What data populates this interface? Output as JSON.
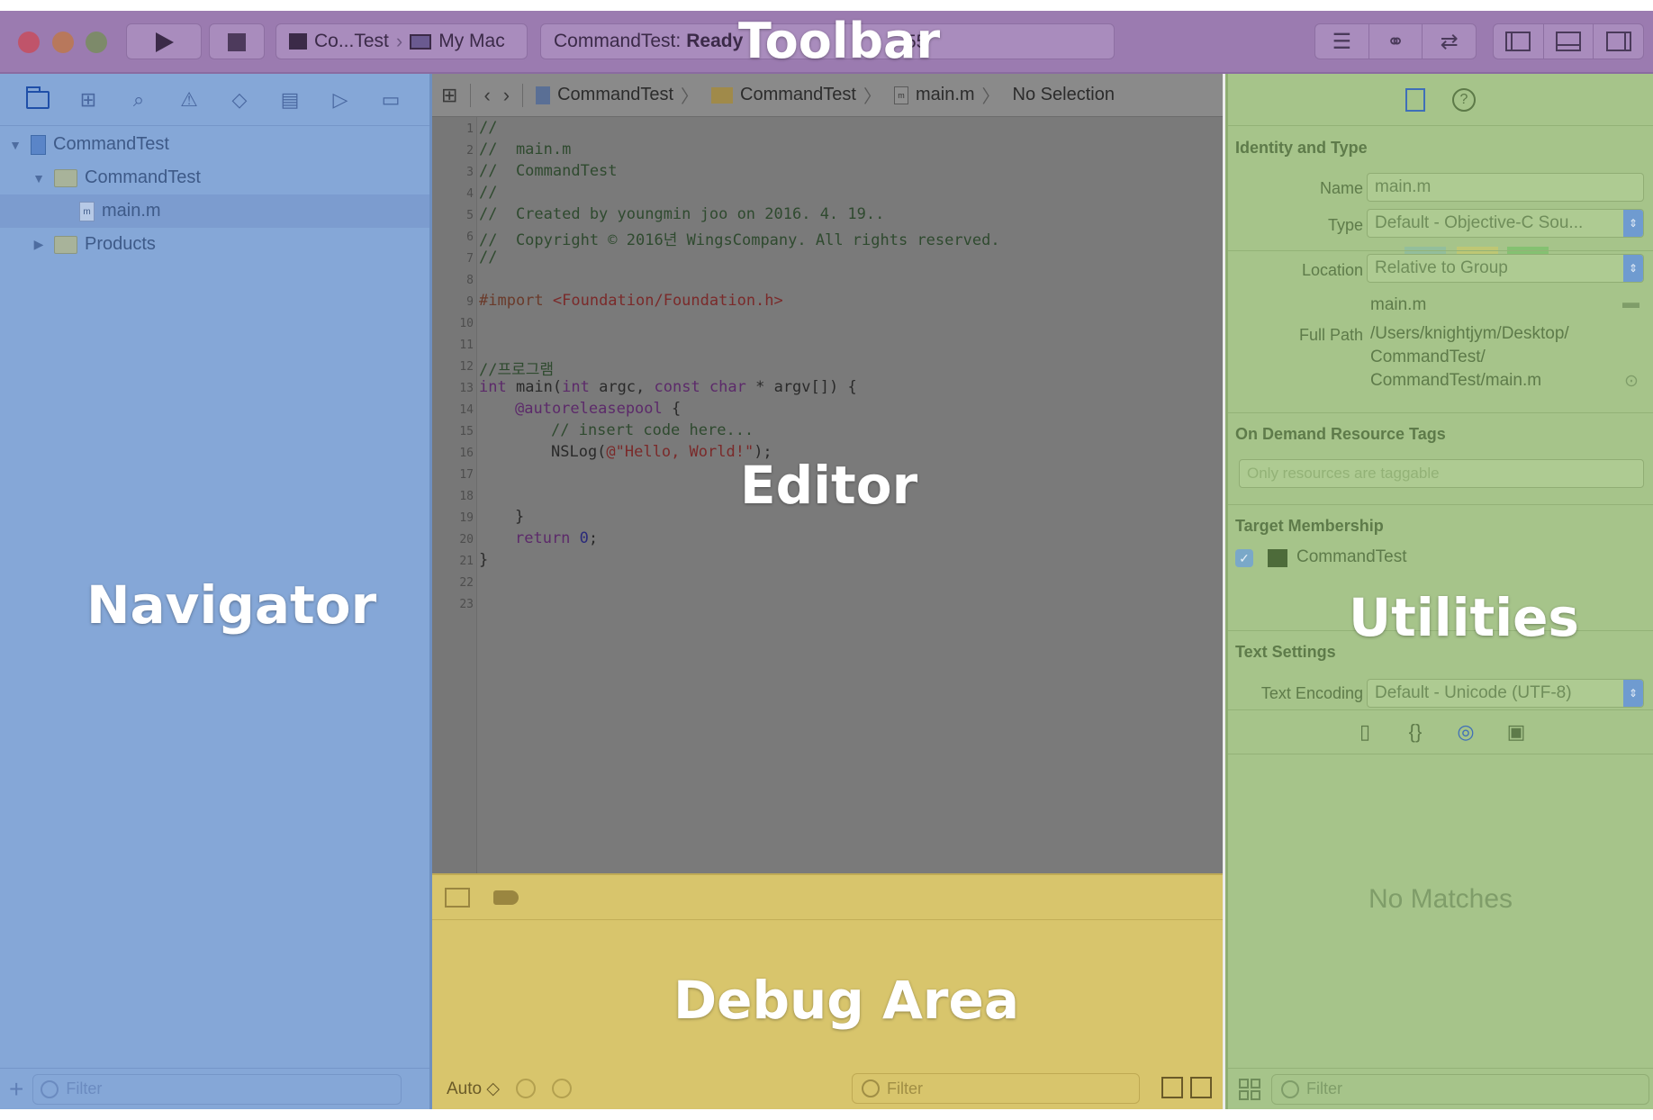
{
  "toolbar": {
    "scheme": {
      "target": "Co...Test",
      "device": "My Mac"
    },
    "status": {
      "project": "CommandTest:",
      "state": "Ready",
      "time": "55"
    }
  },
  "navigator": {
    "tree": [
      {
        "label": "CommandTest",
        "kind": "project"
      },
      {
        "label": "CommandTest",
        "kind": "folder"
      },
      {
        "label": "main.m",
        "kind": "file"
      },
      {
        "label": "Products",
        "kind": "folder"
      }
    ],
    "filter_placeholder": "Filter"
  },
  "editor": {
    "breadcrumbs": [
      "CommandTest",
      "CommandTest",
      "main.m",
      "No Selection"
    ],
    "line_numbers": [
      "1",
      "2",
      "3",
      "4",
      "5",
      "6",
      "7",
      "8",
      "9",
      "10",
      "11",
      "12",
      "13",
      "14",
      "15",
      "16",
      "17",
      "18",
      "19",
      "20",
      "21",
      "22",
      "23"
    ],
    "code": {
      "l1": "//",
      "l2": "//  main.m",
      "l3": "//  CommandTest",
      "l4": "//",
      "l5": "//  Created by youngmin joo on 2016. 4. 19..",
      "l6": "//  Copyright © 2016년 WingsCompany. All rights reserved.",
      "l7": "//",
      "l9a": "#import ",
      "l9b": "<Foundation/Foundation.h>",
      "l12": "//프로그램",
      "l13a": "int",
      "l13b": " main(",
      "l13c": "int",
      "l13d": " argc, ",
      "l13e": "const char",
      "l13f": " * argv[]) {",
      "l14": "@autoreleasepool",
      "l14b": " {",
      "l15": "// insert code here...",
      "l16a": "NSLog(",
      "l16b": "@\"Hello, World!\"",
      "l16c": ");",
      "l19": "}",
      "l20a": "return",
      "l20b": " 0",
      "l20c": ";",
      "l21": "}"
    }
  },
  "debug": {
    "auto_label": "Auto ◇",
    "filter_placeholder": "Filter"
  },
  "utilities": {
    "identity": {
      "section": "Identity and Type",
      "name_label": "Name",
      "name_value": "main.m",
      "type_label": "Type",
      "type_value": "Default - Objective-C Sou...",
      "location_label": "Location",
      "location_value": "Relative to Group",
      "location_file": "main.m",
      "fullpath_label": "Full Path",
      "fullpath_l1": "/Users/knightjym/Desktop/",
      "fullpath_l2": "CommandTest/",
      "fullpath_l3": "CommandTest/main.m"
    },
    "ondemand": {
      "section": "On Demand Resource Tags",
      "placeholder": "Only resources are taggable"
    },
    "membership": {
      "section": "Target Membership",
      "target": "CommandTest"
    },
    "text_settings": {
      "section": "Text Settings",
      "encoding_label": "Text Encoding",
      "encoding_value": "Default - Unicode (UTF-8)"
    },
    "library_empty": "No Matches",
    "filter_placeholder": "Filter"
  },
  "overlay": {
    "toolbar": "Toolbar",
    "navigator": "Navigator",
    "editor": "Editor",
    "debug": "Debug Area",
    "utilities": "Utilities"
  },
  "colors": {
    "toolbar": "#9b7bb0",
    "navigator": "#85a7d7",
    "editor": "#7a7a7a",
    "debug": "#d8c56c",
    "utilities": "#a6c48a"
  }
}
